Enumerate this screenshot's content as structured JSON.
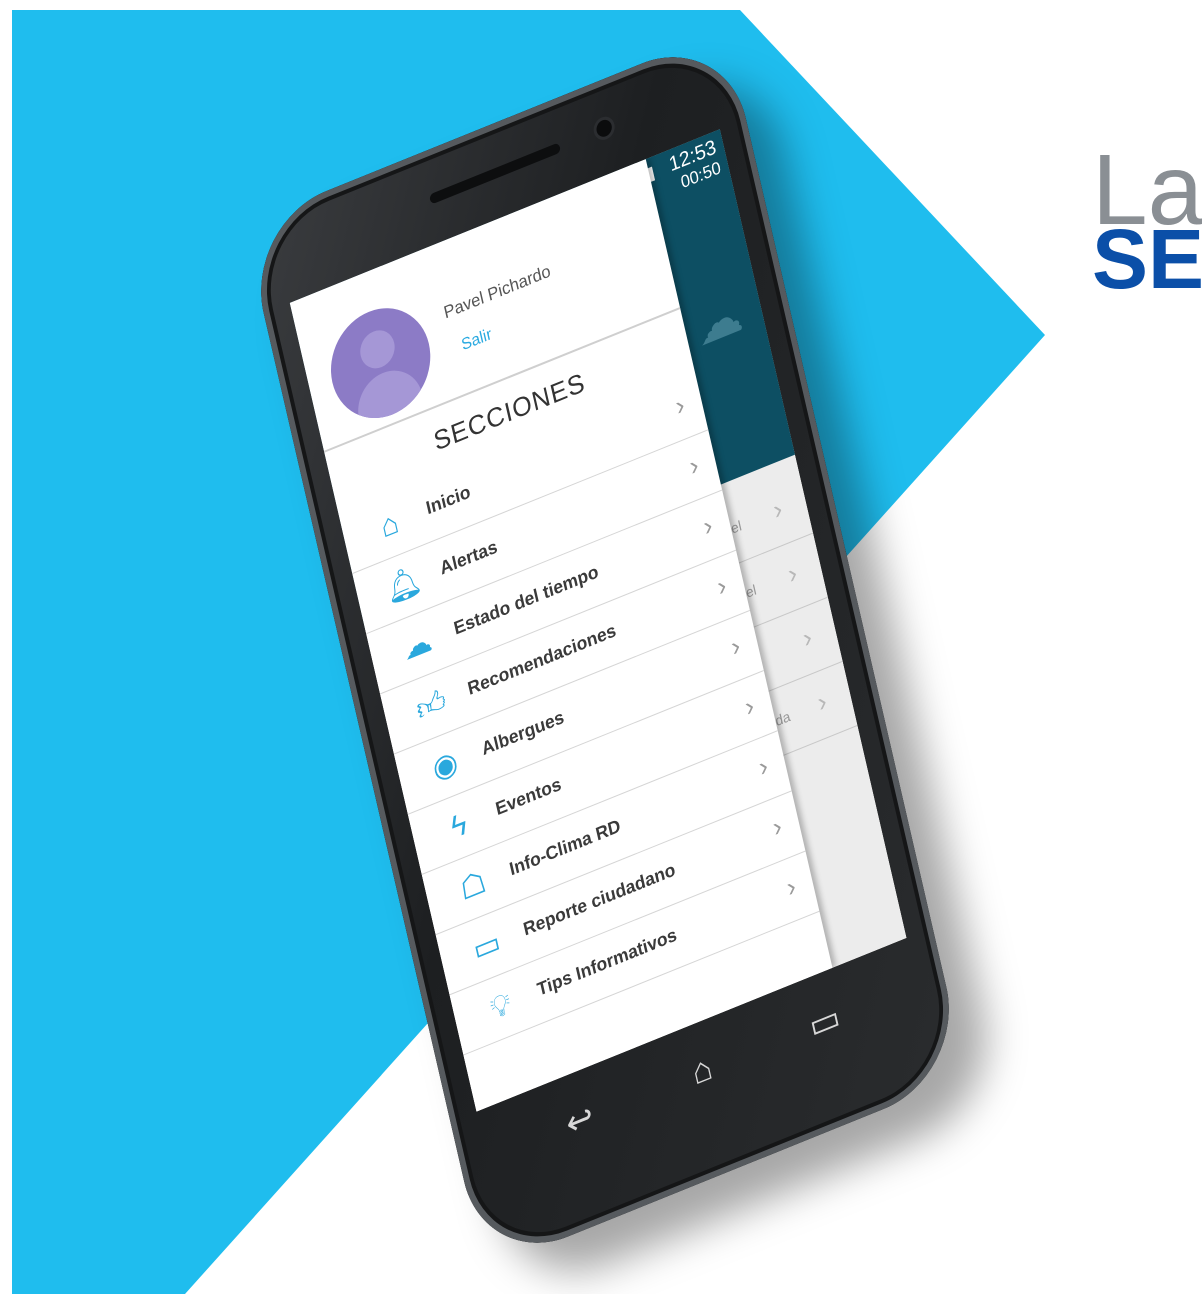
{
  "brand": {
    "line1": "La",
    "line2": "SE"
  },
  "status": {
    "time": "12:53",
    "secondary_time": "00:50"
  },
  "drawer": {
    "profile": {
      "name": "Pavel Pichardo",
      "logout_label": "Salir"
    },
    "section_title": "SECCIONES",
    "items": [
      {
        "label": "Inicio",
        "icon": "home-icon",
        "glyph": "⌂"
      },
      {
        "label": "Alertas",
        "icon": "bell-icon",
        "glyph": "🔔︎"
      },
      {
        "label": "Estado del tiempo",
        "icon": "cloud-rain-icon",
        "glyph": "☁"
      },
      {
        "label": "Recomendaciones",
        "icon": "thumbs-up-icon",
        "glyph": "👍︎"
      },
      {
        "label": "Albergues",
        "icon": "location-pin-icon",
        "glyph": "◉"
      },
      {
        "label": "Eventos",
        "icon": "lightning-icon",
        "glyph": "ϟ"
      },
      {
        "label": "Info-Clima RD",
        "icon": "weather-station-icon",
        "glyph": "☖"
      },
      {
        "label": "Reporte ciudadano",
        "icon": "video-camera-icon",
        "glyph": "▭"
      },
      {
        "label": "Tips Informativos",
        "icon": "lightbulb-icon",
        "glyph": "💡︎"
      }
    ]
  },
  "background_rows": [
    {
      "text": "el"
    },
    {
      "text": "el"
    },
    {
      "text": ""
    },
    {
      "text": "da"
    }
  ],
  "colors": {
    "accent": "#29a9e0",
    "background_blue": "#1fbdee",
    "header_dark": "#0d4f63",
    "brand_blue": "#0b4fa8"
  }
}
